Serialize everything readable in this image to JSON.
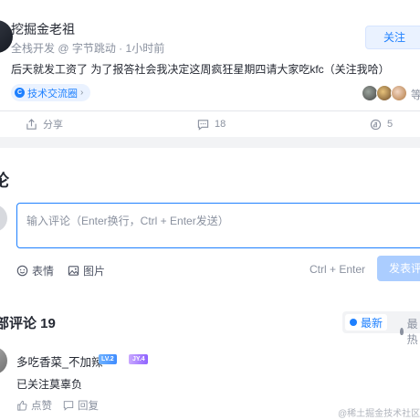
{
  "post": {
    "author_name": "挖掘金老祖",
    "author_meta": "全栈开发 @ 字节跳动 · 1小时前",
    "follow_label": "关注",
    "content": "后天就发工资了 为了报答社会我决定这周疯狂星期四请大家吃kfc（关注我哈）",
    "topic_tag": "技术交流圈",
    "like_more": "等",
    "actions": {
      "share": "分享",
      "comments": "18",
      "likes": "5"
    }
  },
  "comment_box": {
    "title": "论",
    "placeholder": "输入评论（Enter换行，Ctrl + Enter发送）",
    "emoji_label": "表情",
    "image_label": "图片",
    "shortcut": "Ctrl + Enter",
    "submit_label": "发表评论"
  },
  "comments_section": {
    "title": "部评论 19",
    "sort_newest": "最新",
    "sort_hot": "最热"
  },
  "comments": [
    {
      "user": "多吃香菜_不加辣",
      "level_badge": "LV.2",
      "jy_badge": "JY.4",
      "text": "已关注莫辜负",
      "like_label": "点赞",
      "reply_label": "回复"
    }
  ],
  "watermark": "@稀土掘金技术社区",
  "colors": {
    "accent": "#1e80ff",
    "text": "#252933",
    "muted": "#8a919f",
    "background": "#f2f3f5"
  }
}
